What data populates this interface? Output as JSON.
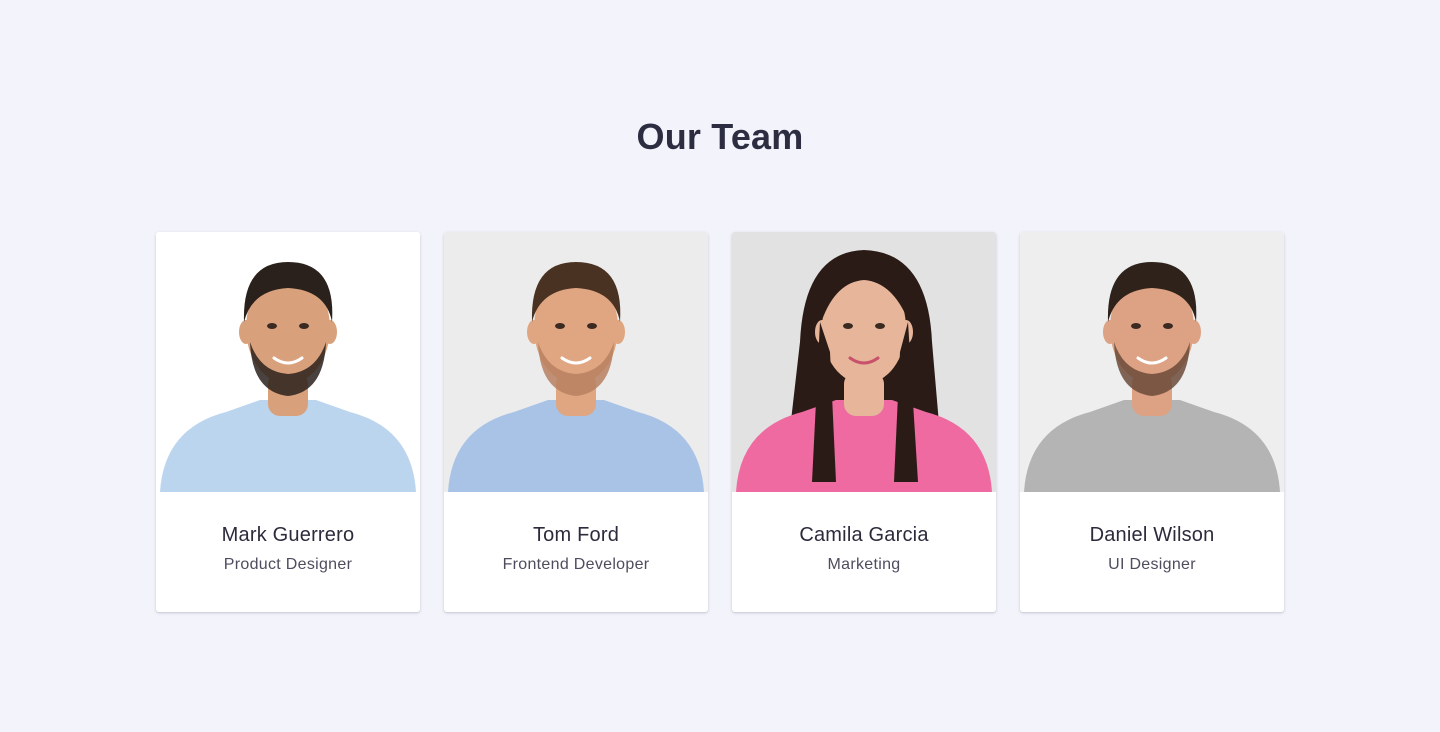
{
  "section": {
    "title": "Our Team"
  },
  "members": [
    {
      "name": "Mark Guerrero",
      "role": "Product Designer",
      "photo": {
        "bg": "#ffffff",
        "skin": "#d9a07c",
        "hair": "#2a211c",
        "beard": "#2a211c",
        "shirt": "#bcd5ee"
      }
    },
    {
      "name": "Tom Ford",
      "role": "Frontend Developer",
      "photo": {
        "bg": "#ececec",
        "skin": "#e0a682",
        "hair": "#4a3222",
        "beard": "#b78060",
        "shirt": "#a9c3e6"
      }
    },
    {
      "name": "Camila Garcia",
      "role": "Marketing",
      "photo": {
        "bg": "#e2e2e2",
        "skin": "#e6b59a",
        "hair": "#2b1b16",
        "beard": "",
        "shirt": "#ee6aa0"
      }
    },
    {
      "name": "Daniel Wilson",
      "role": "UI Designer",
      "photo": {
        "bg": "#eeeeee",
        "skin": "#dca283",
        "hair": "#2f221b",
        "beard": "#6b4a3a",
        "shirt": "#b4b4b4"
      }
    }
  ]
}
